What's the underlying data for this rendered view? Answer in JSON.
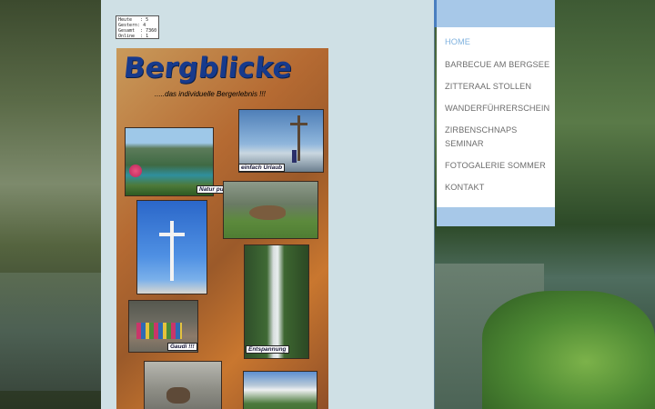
{
  "visitor_counter": {
    "heute": "Heute   : 5",
    "gestern": "Gestern: 4",
    "gesamt": "Gesamt  : 7360",
    "online": "Online  : 1"
  },
  "poster": {
    "title": "Bergblicke",
    "subtitle": ".....das individuelle Bergerlebnis !!!",
    "labels": {
      "natur": "Natur pur",
      "urlaub": "einfach Urlaub",
      "gaudi": "Gaudi !!!",
      "entspannung": "Entspannung"
    }
  },
  "navigation": {
    "items": [
      {
        "label": "HOME",
        "active": true
      },
      {
        "label": "BARBECUE AM BERGSEE"
      },
      {
        "label": "ZITTERAAL STOLLEN"
      },
      {
        "label": "WANDERFÜHRERSCHEIN"
      },
      {
        "label": "ZIRBENSCHNAPS"
      },
      {
        "label": "SEMINAR"
      },
      {
        "label": "FOTOGALERIE SOMMER"
      },
      {
        "label": "KONTAKT"
      }
    ]
  },
  "colors": {
    "content_bg": "#cfe0e5",
    "nav_bg": "#ffffff",
    "nav_frame": "#a7c8e8",
    "nav_active": "#7fb2df",
    "nav_text": "#6d6d6d",
    "poster_title": "#173a8c"
  }
}
